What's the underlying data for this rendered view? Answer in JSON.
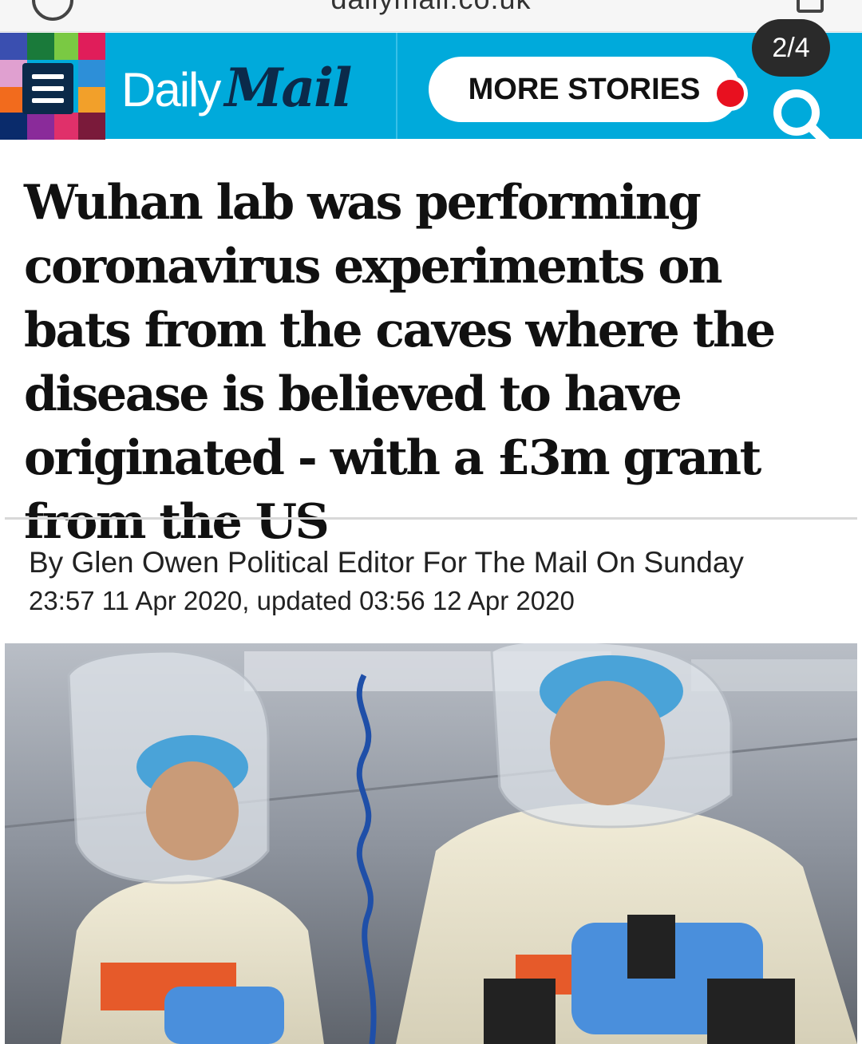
{
  "browser": {
    "url": "dailymail.co.uk"
  },
  "masthead": {
    "logo_daily": "Daily",
    "logo_mail": "Mail",
    "more_stories_label": "MORE STORIES",
    "page_counter": "2/4",
    "brand_color": "#00aadb",
    "notification_color": "#e8101f"
  },
  "icons": [
    "menu-icon",
    "search-icon",
    "info-icon",
    "tabs-icon"
  ],
  "article": {
    "headline": "Wuhan lab was performing coronavirus experiments on bats from the caves where the disease is believed to have originated - with a £3m grant from the US",
    "byline": "By Glen Owen Political Editor For The Mail On Sunday",
    "dateline": "23:57 11 Apr 2020, updated 03:56 12 Apr 2020"
  }
}
